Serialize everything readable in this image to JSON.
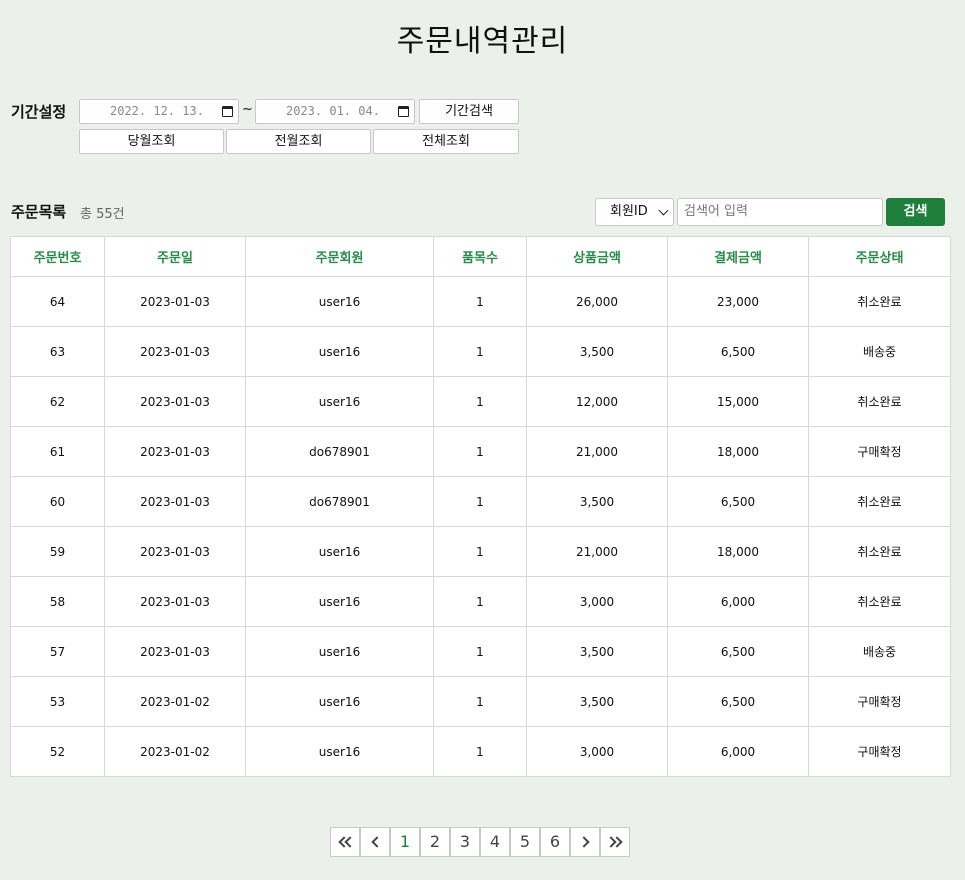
{
  "page": {
    "title": "주문내역관리"
  },
  "period": {
    "label": "기간설정",
    "start_date": "2022. 12. 13.",
    "end_date": "2023. 01. 04.",
    "separator": "~",
    "search_label": "기간검색",
    "this_month_label": "당월조회",
    "last_month_label": "전월조회",
    "all_label": "전체조회"
  },
  "list": {
    "title": "주문목록",
    "count_text": "총 55건",
    "filter_selected": "회원ID",
    "search_placeholder": "검색어 입력",
    "search_button": "검색"
  },
  "table": {
    "headers": [
      "주문번호",
      "주문일",
      "주문회원",
      "품목수",
      "상품금액",
      "결제금액",
      "주문상태"
    ],
    "rows": [
      [
        "64",
        "2023-01-03",
        "user16",
        "1",
        "26,000",
        "23,000",
        "취소완료"
      ],
      [
        "63",
        "2023-01-03",
        "user16",
        "1",
        "3,500",
        "6,500",
        "배송중"
      ],
      [
        "62",
        "2023-01-03",
        "user16",
        "1",
        "12,000",
        "15,000",
        "취소완료"
      ],
      [
        "61",
        "2023-01-03",
        "do678901",
        "1",
        "21,000",
        "18,000",
        "구매확정"
      ],
      [
        "60",
        "2023-01-03",
        "do678901",
        "1",
        "3,500",
        "6,500",
        "취소완료"
      ],
      [
        "59",
        "2023-01-03",
        "user16",
        "1",
        "21,000",
        "18,000",
        "취소완료"
      ],
      [
        "58",
        "2023-01-03",
        "user16",
        "1",
        "3,000",
        "6,000",
        "취소완료"
      ],
      [
        "57",
        "2023-01-03",
        "user16",
        "1",
        "3,500",
        "6,500",
        "배송중"
      ],
      [
        "53",
        "2023-01-02",
        "user16",
        "1",
        "3,500",
        "6,500",
        "구매확정"
      ],
      [
        "52",
        "2023-01-02",
        "user16",
        "1",
        "3,000",
        "6,000",
        "구매확정"
      ]
    ]
  },
  "pagination": {
    "pages": [
      "1",
      "2",
      "3",
      "4",
      "5",
      "6"
    ],
    "current": "1"
  },
  "colors": {
    "background": "#ebf1ea",
    "accent": "#1e7e3a",
    "header_text": "#2a8a4a"
  }
}
